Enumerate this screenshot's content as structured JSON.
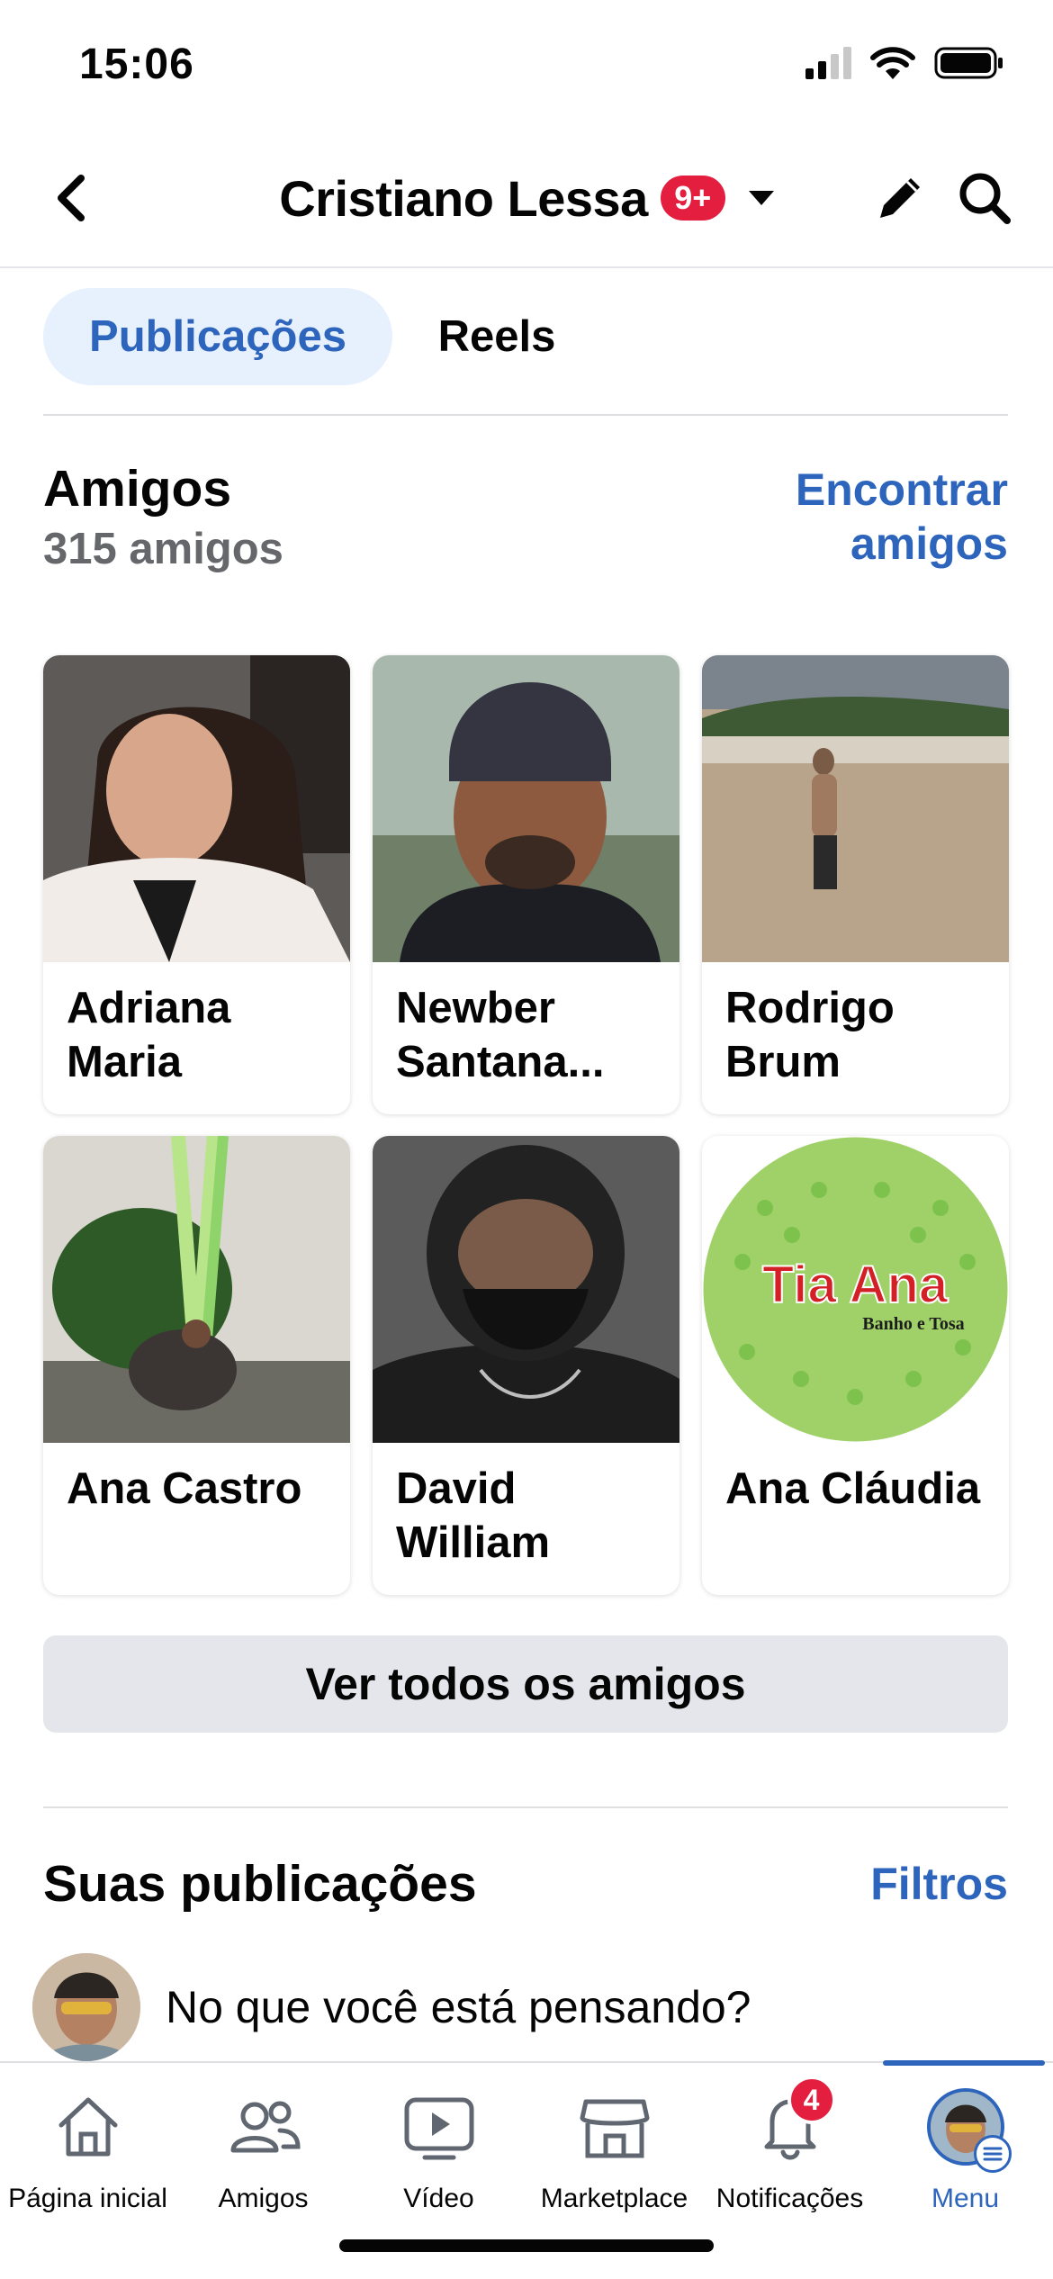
{
  "status_bar": {
    "time": "15:06"
  },
  "header": {
    "title": "Cristiano Lessa",
    "badge": "9+",
    "icons": {
      "back": "chevron-left-icon",
      "edit": "pencil-icon",
      "search": "search-icon"
    }
  },
  "tabs": [
    {
      "label": "Publicações",
      "active": true
    },
    {
      "label": "Reels",
      "active": false
    }
  ],
  "friends": {
    "heading": "Amigos",
    "count": "315 amigos",
    "find_label": "Encontrar amigos",
    "list": [
      {
        "name": "Adriana Maria"
      },
      {
        "name": "Newber Santana..."
      },
      {
        "name": "Rodrigo Brum"
      },
      {
        "name": "Ana Castro"
      },
      {
        "name": "David William"
      },
      {
        "name": "Ana Cláudia",
        "logo_text": "Tia Ana",
        "logo_subtext": "Banho e Tosa"
      }
    ],
    "see_all_label": "Ver todos os amigos"
  },
  "posts": {
    "heading": "Suas publicações",
    "filters_label": "Filtros",
    "composer_placeholder": "No que você está pensando?"
  },
  "bottom_nav": [
    {
      "label": "Página inicial",
      "icon": "home-icon"
    },
    {
      "label": "Amigos",
      "icon": "friends-icon"
    },
    {
      "label": "Vídeo",
      "icon": "video-icon"
    },
    {
      "label": "Marketplace",
      "icon": "marketplace-icon"
    },
    {
      "label": "Notificações",
      "icon": "bell-icon",
      "badge": "4"
    },
    {
      "label": "Menu",
      "icon": "menu-avatar-icon",
      "active": true
    }
  ],
  "colors": {
    "accent": "#2d64bc",
    "badge": "#e41e3f",
    "tab_active_bg": "#e7f0fd",
    "button_bg": "#e4e6eb"
  }
}
